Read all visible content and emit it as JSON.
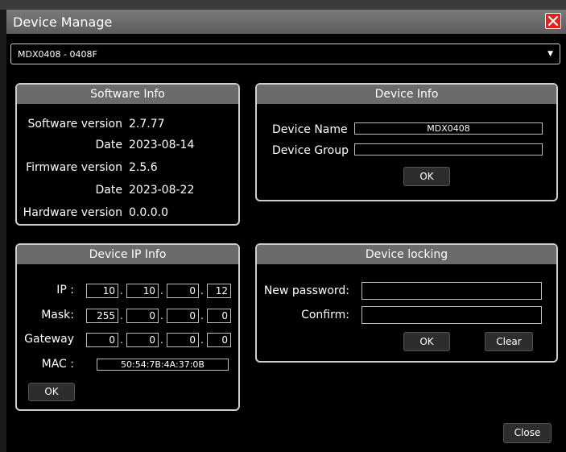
{
  "window": {
    "title": "Device Manage"
  },
  "device_select": {
    "value": "MDX0408 - 0408F"
  },
  "software_info": {
    "heading": "Software Info",
    "rows": [
      {
        "label": "Software version",
        "value": "2.7.77"
      },
      {
        "label": "Date",
        "value": "2023-08-14"
      },
      {
        "label": "Firmware version",
        "value": "2.5.6"
      },
      {
        "label": "Date",
        "value": "2023-08-22"
      },
      {
        "label": "Hardware version",
        "value": "0.0.0.0"
      }
    ]
  },
  "device_info": {
    "heading": "Device Info",
    "name_label": "Device Name",
    "name_value": "MDX0408",
    "group_label": "Device Group",
    "group_value": "",
    "ok_label": "OK"
  },
  "ip_info": {
    "heading": "Device IP Info",
    "ip_label": "IP :",
    "ip": [
      "10",
      "10",
      "0",
      "12"
    ],
    "mask_label": "Mask:",
    "mask": [
      "255",
      "0",
      "0",
      "0"
    ],
    "gateway_label": "Gateway",
    "gateway": [
      "0",
      "0",
      "0",
      "0"
    ],
    "mac_label": "MAC :",
    "mac": "50:54:7B:4A:37:0B",
    "ok_label": "OK"
  },
  "locking": {
    "heading": "Device locking",
    "new_label": "New password:",
    "confirm_label": "Confirm:",
    "ok_label": "OK",
    "clear_label": "Clear"
  },
  "footer": {
    "close_label": "Close"
  }
}
